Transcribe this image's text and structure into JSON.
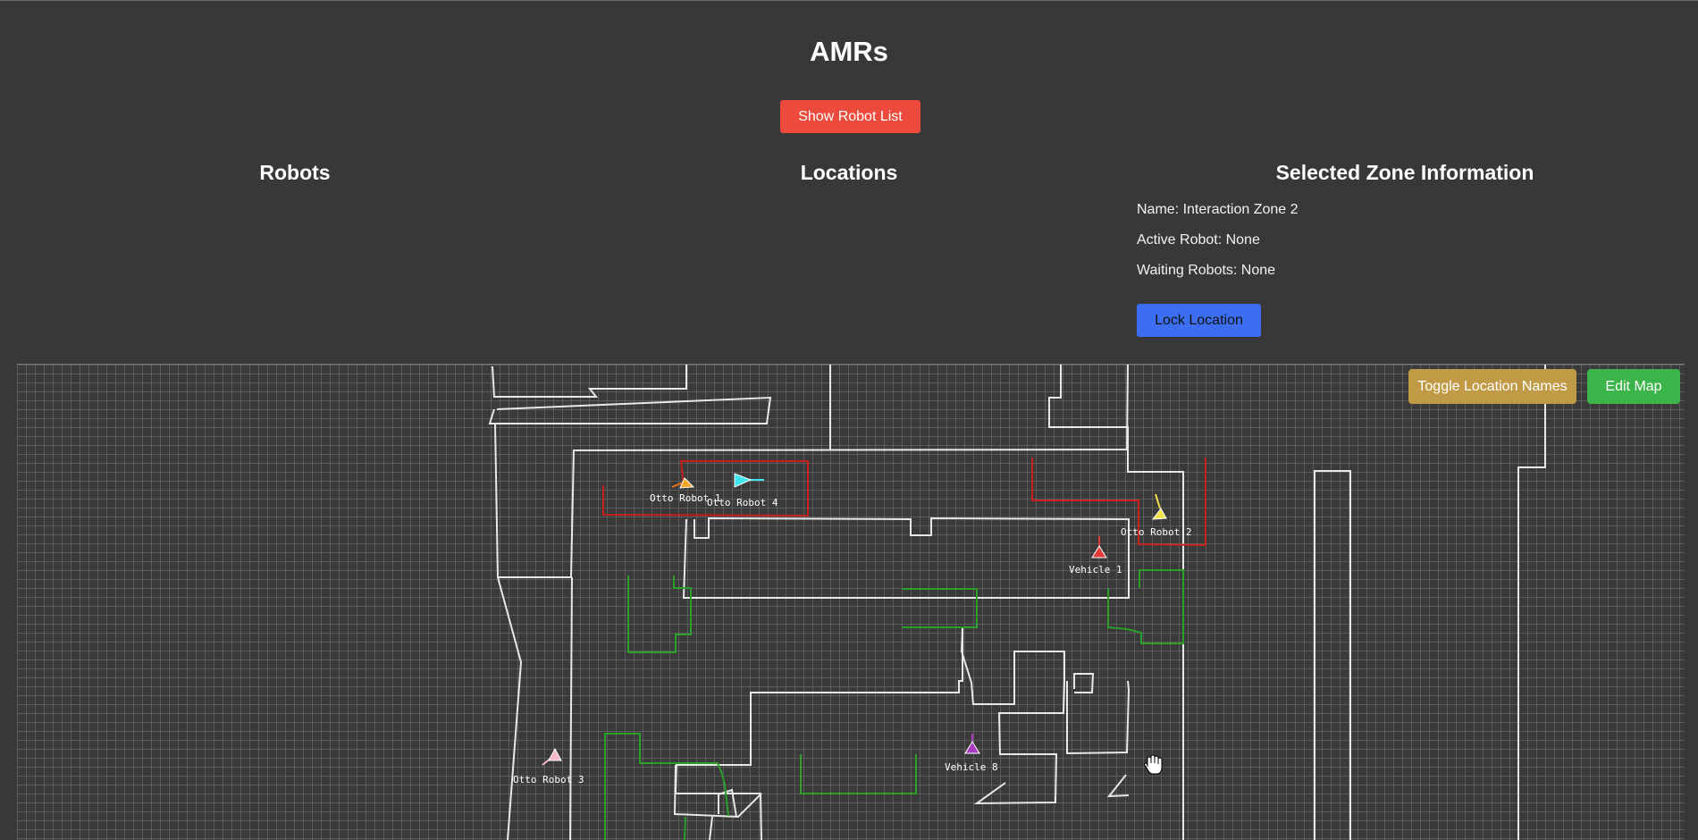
{
  "app": {
    "title": "AMRs",
    "show_robot_list_label": "Show Robot List"
  },
  "sections": {
    "robots": "Robots",
    "locations": "Locations",
    "zone_info": "Selected Zone Information"
  },
  "zone": {
    "name_line": "Name: Interaction Zone 2",
    "active_line": "Active Robot: None",
    "waiting_line": "Waiting Robots: None",
    "lock_label": "Lock Location"
  },
  "map": {
    "toggle_names_label": "Toggle Location Names",
    "edit_map_label": "Edit Map",
    "robots": [
      {
        "label": "Otto Robot 1",
        "color": "#f5a623",
        "icon": "triangle-robot-icon"
      },
      {
        "label": "Otto Robot 4",
        "color": "#3fe6ef",
        "icon": "triangle-robot-icon"
      },
      {
        "label": "Otto Robot 2",
        "color": "#f2e24a",
        "icon": "triangle-robot-icon"
      },
      {
        "label": "Vehicle 1",
        "color": "#e23b3b",
        "icon": "triangle-robot-icon"
      },
      {
        "label": "Vehicle 8",
        "color": "#a63cc0",
        "icon": "triangle-robot-icon"
      },
      {
        "label": "Otto Robot 3",
        "color": "#f5b8c8",
        "icon": "triangle-robot-icon"
      }
    ],
    "cursor_icon": "hand-cursor-icon"
  }
}
